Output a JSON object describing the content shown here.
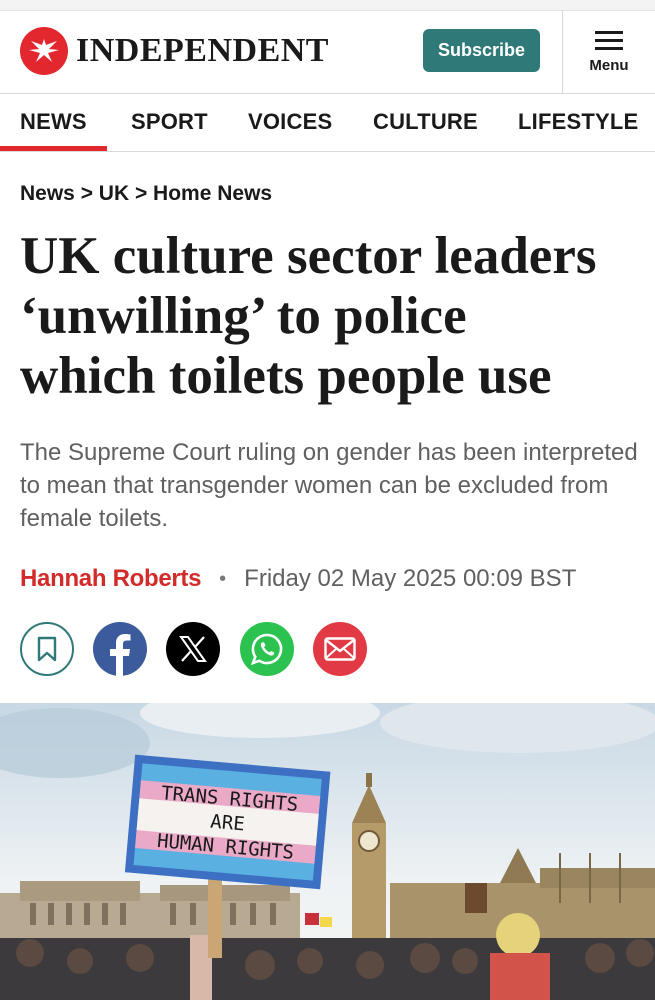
{
  "header": {
    "logo_text": "INDEPENDENT",
    "subscribe_label": "Subscribe",
    "menu_label": "Menu"
  },
  "nav": {
    "items": [
      "NEWS",
      "SPORT",
      "VOICES",
      "CULTURE",
      "LIFESTYLE"
    ],
    "active": "NEWS"
  },
  "article": {
    "breadcrumb": "News > UK > Home News",
    "headline_lines": [
      "UK culture sector leaders",
      "‘unwilling’ to police",
      "which toilets people use"
    ],
    "standfirst": "The Supreme Court ruling on gender has been interpreted to mean that transgender women can be excluded from female toilets.",
    "author": "Hannah Roberts",
    "separator": "•",
    "date": "Friday 02 May 2025 00:09 BST"
  },
  "share": {
    "icons": [
      "bookmark-icon",
      "facebook-icon",
      "x-icon",
      "whatsapp-icon",
      "email-icon"
    ]
  },
  "image": {
    "sign_text": [
      "TRANS RIGHTS",
      "ARE",
      "HUMAN RIGHTS"
    ]
  },
  "colors": {
    "brand_red": "#e2272e",
    "subscribe_teal": "#2f7a78",
    "facebook_blue": "#3b5b9d",
    "whatsapp_green": "#2bc24f",
    "email_red": "#e23a44"
  }
}
